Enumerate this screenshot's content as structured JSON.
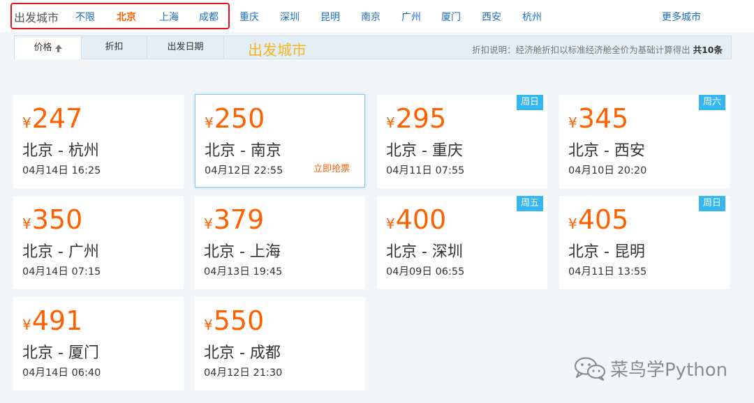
{
  "city_bar": {
    "label": "出发城市",
    "cities": [
      "不限",
      "北京",
      "上海",
      "成都",
      "重庆",
      "深圳",
      "昆明",
      "南京",
      "广州",
      "厦门",
      "西安",
      "杭州"
    ],
    "active_city": "北京",
    "more_label": "更多城市"
  },
  "tabs": {
    "price_label": "价格",
    "discount_label": "折扣",
    "date_label": "出发日期",
    "overlay_label": "出发城市"
  },
  "discount_note": {
    "text": "折扣说明：经济舱折扣以标准经济舱全价为基础计算得出",
    "total": "共10条"
  },
  "currency_symbol": "¥",
  "flights": [
    {
      "price": "247",
      "route": "北京 - 杭州",
      "datetime": "04月14日 16:25",
      "weekday": ""
    },
    {
      "price": "250",
      "route": "北京 - 南京",
      "datetime": "04月12日 22:55",
      "weekday": "",
      "buy_label": "立即抢票"
    },
    {
      "price": "295",
      "route": "北京 - 重庆",
      "datetime": "04月11日 07:55",
      "weekday": "周日"
    },
    {
      "price": "345",
      "route": "北京 - 西安",
      "datetime": "04月10日 20:20",
      "weekday": "周六"
    },
    {
      "price": "350",
      "route": "北京 - 广州",
      "datetime": "04月14日 07:15",
      "weekday": ""
    },
    {
      "price": "379",
      "route": "北京 - 上海",
      "datetime": "04月13日 19:45",
      "weekday": ""
    },
    {
      "price": "400",
      "route": "北京 - 深圳",
      "datetime": "04月09日 06:55",
      "weekday": "周五"
    },
    {
      "price": "405",
      "route": "北京 - 昆明",
      "datetime": "04月11日 13:55",
      "weekday": "周日"
    },
    {
      "price": "491",
      "route": "北京 - 厦门",
      "datetime": "04月14日 06:40",
      "weekday": ""
    },
    {
      "price": "550",
      "route": "北京 - 成都",
      "datetime": "04月12日 21:30",
      "weekday": ""
    }
  ],
  "watermark": "菜鸟学Python",
  "colors": {
    "accent_orange": "#ff6000",
    "link_blue": "#1a6fc7",
    "badge_blue": "#35b7f2",
    "highlight_red": "#e8101c",
    "overlay_yellow": "#f7b520"
  }
}
